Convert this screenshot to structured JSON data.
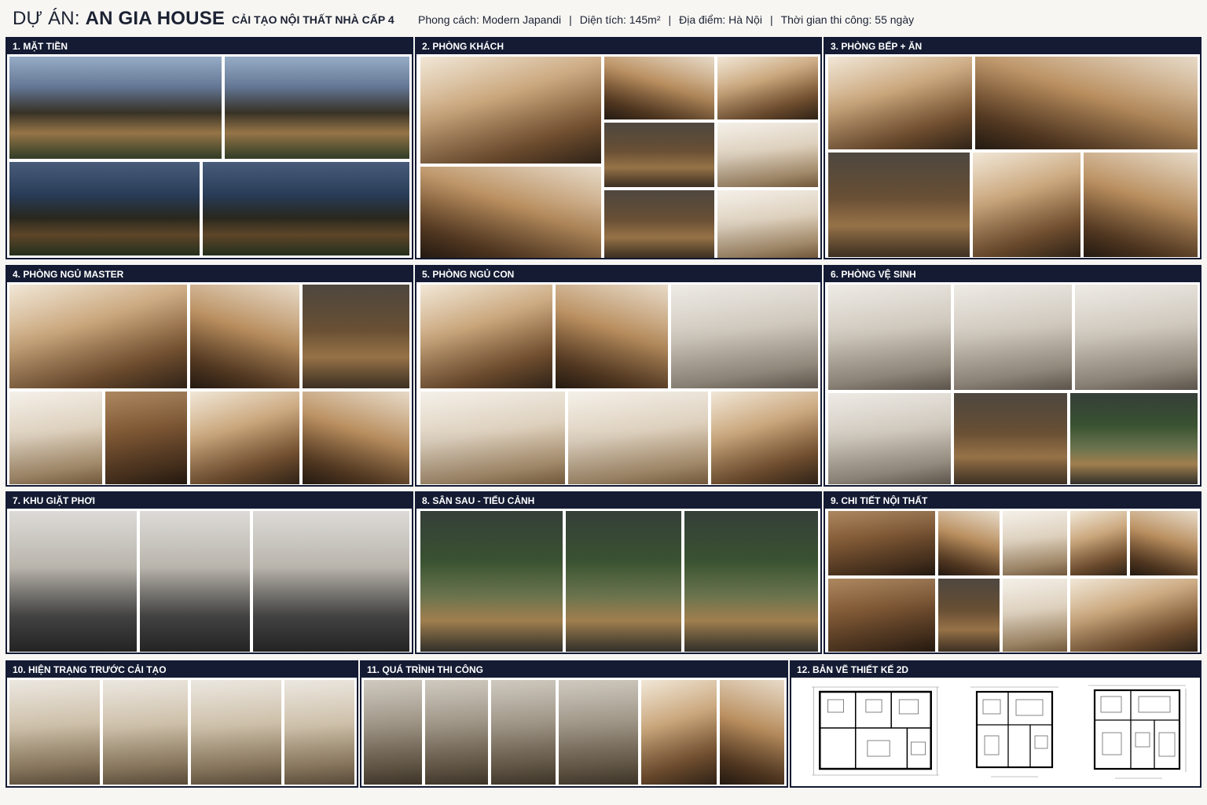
{
  "header": {
    "title_prefix": "DỰ ÁN:",
    "title_name": "AN GIA HOUSE",
    "subtitle": "CẢI TẠO NỘI THẤT NHÀ CẤP 4",
    "style": "Phong cách: Modern Japandi",
    "area": "Diện tích: 145m²",
    "location": "Địa điểm: Hà Nội",
    "duration": "Thời gian thi công: 55 ngày",
    "separator": "|"
  },
  "panels": {
    "p1": "1. MẶT TIỀN",
    "p2": "2. PHÒNG KHÁCH",
    "p3": "3. PHÒNG BẾP + ĂN",
    "p4": "4. PHÒNG NGỦ MASTER",
    "p5": "5. PHÒNG NGỦ CON",
    "p6": "6. PHÒNG VỆ SINH",
    "p7": "7. KHU GIẶT PHƠI",
    "p8": "8. SÂN SAU - TIỂU CẢNH",
    "p9": "9. CHI TIẾT NỘI THẤT",
    "p10": "10. HIỆN TRẠNG TRƯỚC CẢI TẠO",
    "p11": "11. QUÁ TRÌNH THI CÔNG",
    "p12": "12. BẢN VẼ THIẾT KẾ 2D"
  }
}
